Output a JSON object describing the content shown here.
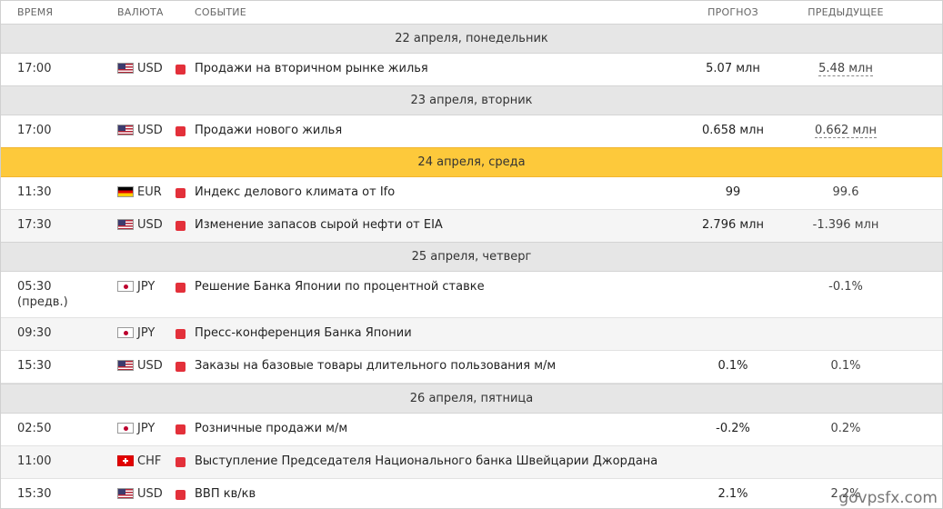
{
  "header": {
    "time": "ВРЕМЯ",
    "currency": "ВАЛЮТА",
    "event": "СОБЫТИЕ",
    "forecast": "ПРОГНОЗ",
    "previous": "ПРЕДЫДУЩЕЕ"
  },
  "days": [
    {
      "label": "22 апреля, понедельник",
      "events": [
        {
          "time": "17:00",
          "currency": "USD",
          "flag": "us-flag",
          "event": "Продажи на вторичном рынке жилья",
          "forecast": "5.07 млн",
          "previous": "5.48 млн",
          "previous_revised": true
        }
      ]
    },
    {
      "label": "23 апреля, вторник",
      "events": [
        {
          "time": "17:00",
          "currency": "USD",
          "flag": "us-flag",
          "event": "Продажи нового жилья",
          "forecast": "0.658 млн",
          "previous": "0.662 млн",
          "previous_revised": true
        }
      ]
    },
    {
      "label": "24 апреля, среда",
      "highlight_color": "#fdc93b",
      "events": [
        {
          "time": "11:30",
          "currency": "EUR",
          "flag": "de-flag",
          "event": "Индекс делового климата от Ifo",
          "forecast": "99",
          "previous": "99.6"
        },
        {
          "time": "17:30",
          "currency": "USD",
          "flag": "us-flag",
          "event": "Изменение запасов сырой нефти от EIA",
          "forecast": "2.796 млн",
          "previous": "-1.396 млн"
        }
      ]
    },
    {
      "label": "25 апреля, четверг",
      "events": [
        {
          "time": "05:30",
          "time_note": "(предв.)",
          "currency": "JPY",
          "flag": "jp-flag",
          "event": "Решение Банка Японии по процентной ставке",
          "forecast": "",
          "previous": "-0.1%"
        },
        {
          "time": "09:30",
          "currency": "JPY",
          "flag": "jp-flag",
          "event": "Пресс-конференция Банка Японии",
          "forecast": "",
          "previous": ""
        },
        {
          "time": "15:30",
          "currency": "USD",
          "flag": "us-flag",
          "event": "Заказы на базовые товары длительного пользования м/м",
          "forecast": "0.1%",
          "previous": "0.1%"
        }
      ]
    },
    {
      "label": "26 апреля, пятница",
      "events": [
        {
          "time": "02:50",
          "currency": "JPY",
          "flag": "jp-flag",
          "event": "Розничные продажи м/м",
          "forecast": "-0.2%",
          "previous": "0.2%"
        },
        {
          "time": "11:00",
          "currency": "CHF",
          "flag": "ch-flag",
          "event": "Выступление Председателя Национального банка Швейцарии Джордана",
          "forecast": "",
          "previous": ""
        },
        {
          "time": "15:30",
          "currency": "USD",
          "flag": "us-flag",
          "event": "ВВП кв/кв",
          "forecast": "2.1%",
          "previous": "2.2%"
        }
      ]
    }
  ],
  "importance_color": "#e3303a",
  "watermark": "govpsfx.com"
}
